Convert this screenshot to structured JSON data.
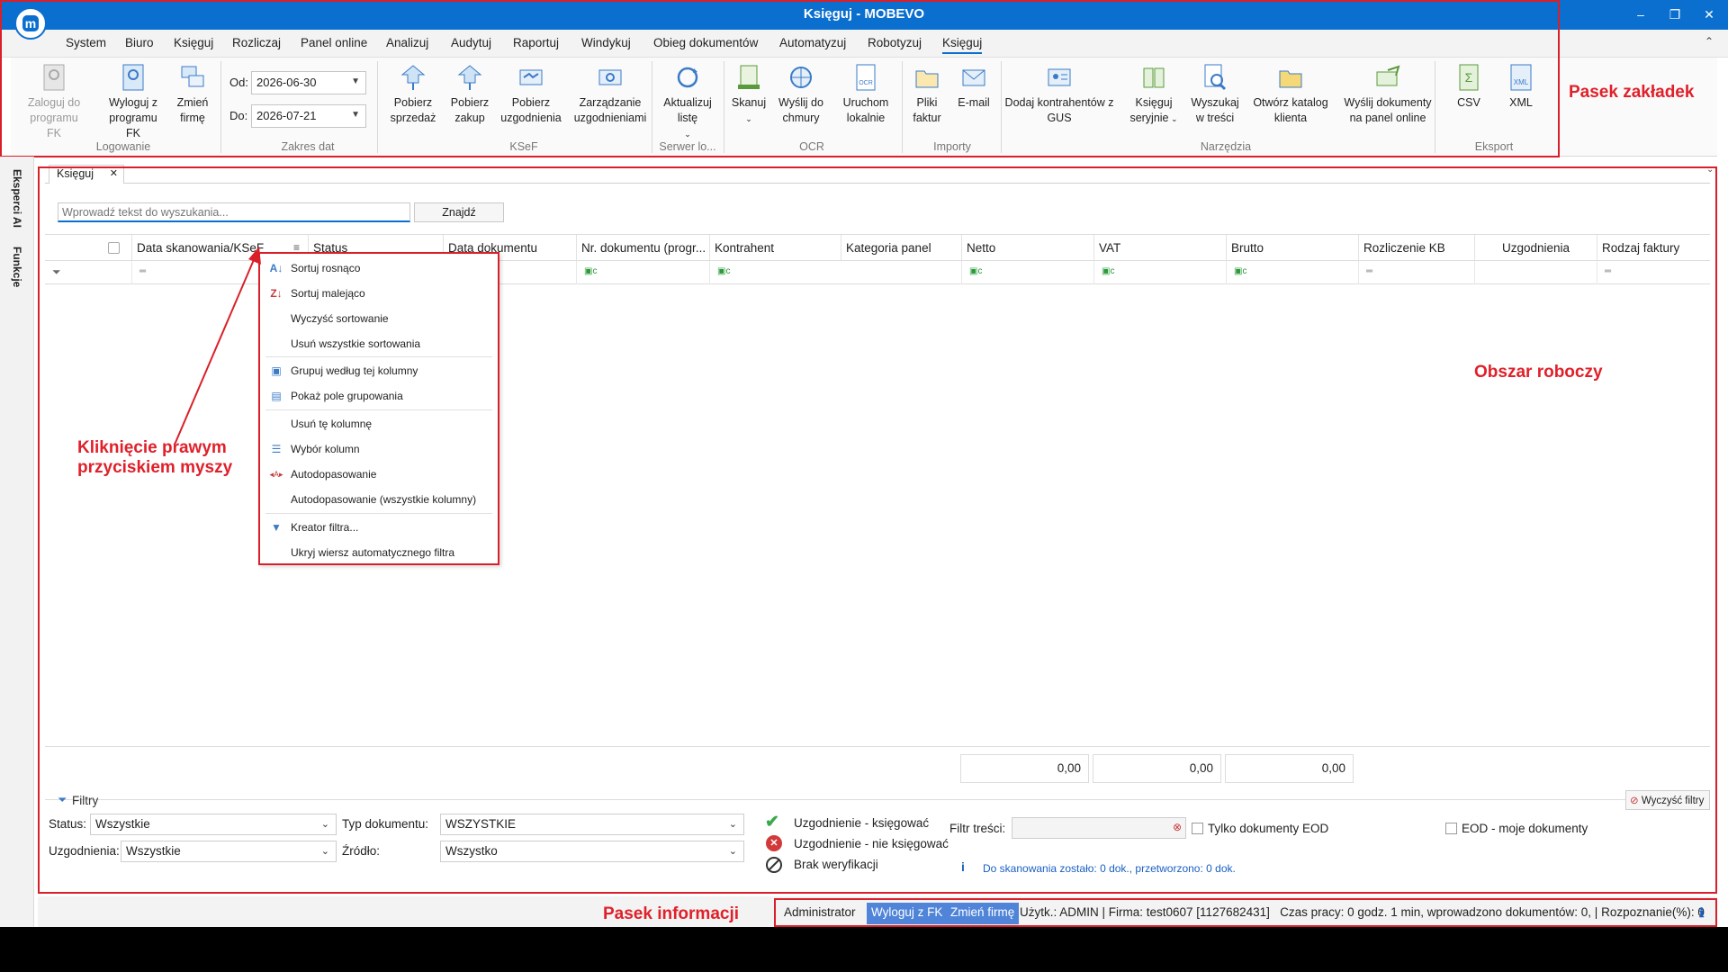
{
  "window": {
    "title": "Księguj  - MOBEVO",
    "minimize": "–",
    "restore": "❐",
    "close": "✕"
  },
  "menu": [
    "System",
    "Biuro",
    "Księguj",
    "Rozliczaj",
    "Panel online",
    "Analizuj",
    "Audytuj",
    "Raportuj",
    "Windykuj",
    "Obieg dokumentów",
    "Automatyzuj",
    "Robotyzuj",
    "Księguj"
  ],
  "ribbon": {
    "logowanie": {
      "login": "Zaloguj do programu FK",
      "logout": "Wyloguj z programu FK",
      "change": "Zmień firmę",
      "label": "Logowanie"
    },
    "dates": {
      "from_label": "Od:",
      "from": "2026-06-30",
      "to_label": "Do:",
      "to": "2026-07-21",
      "label": "Zakres dat"
    },
    "ksef": {
      "sales": "Pobierz sprzedaż",
      "purchase": "Pobierz zakup",
      "agreements": "Pobierz uzgodnienia",
      "manage": "Zarządzanie uzgodnieniami",
      "label": "KSeF"
    },
    "server": {
      "update": "Aktualizuj listę",
      "label": "Serwer lo..."
    },
    "ocr": {
      "scan": "Skanuj",
      "send_cloud": "Wyślij do chmury",
      "run_local": "Uruchom lokalnie",
      "label": "OCR"
    },
    "imports": {
      "files": "Pliki faktur",
      "email": "E-mail",
      "label": "Importy"
    },
    "tools": {
      "add_gus": "Dodaj kontrahentów z GUS",
      "serial": "Księguj seryjnie",
      "search_content": "Wyszukaj w treści",
      "open_catalog": "Otwórz katalog klienta",
      "send_panel": "Wyślij dokumenty na panel online",
      "label": "Narzędzia"
    },
    "export": {
      "csv": "CSV",
      "xml": "XML",
      "label": "Eksport"
    }
  },
  "annotations": {
    "tabs_bar": "Pasek zakładek",
    "workspace": "Obszar roboczy",
    "right_click": "Kliknięcie prawym przyciskiem myszy",
    "info_bar": "Pasek informacji"
  },
  "side": {
    "experts": "Eksperci AI",
    "functions": "Funkcje"
  },
  "workspace": {
    "tab": "Księguj",
    "search_placeholder": "Wprowadź tekst do wyszukania...",
    "find": "Znajdź",
    "columns": [
      "Data skanowania/KSeF",
      "Status",
      "Data dokumentu",
      "Nr. dokumentu (progr...",
      "Kontrahent",
      "Kategoria panel",
      "Netto",
      "VAT",
      "Brutto",
      "Rozliczenie KB",
      "Uzgodnienia",
      "Rodzaj faktury"
    ],
    "sums": [
      "0,00",
      "0,00",
      "0,00"
    ]
  },
  "context_menu": [
    "Sortuj rosnąco",
    "Sortuj malejąco",
    "Wyczyść sortowanie",
    "Usuń wszystkie sortowania",
    "Grupuj według tej kolumny",
    "Pokaż pole grupowania",
    "Usuń tę kolumnę",
    "Wybór kolumn",
    "Autodopasowanie",
    "Autodopasowanie (wszystkie kolumny)",
    "Kreator filtra...",
    "Ukryj wiersz automatycznego filtra"
  ],
  "filters": {
    "title": "Filtry",
    "clear": "Wyczyść filtry",
    "status_label": "Status:",
    "status": "Wszystkie",
    "agreements_label": "Uzgodnienia:",
    "agreements": "Wszystkie",
    "doctype_label": "Typ dokumentu:",
    "doctype": "WSZYSTKIE",
    "source_label": "Źródło:",
    "source": "Wszystko",
    "legend": [
      "Uzgodnienie - księgować",
      "Uzgodnienie - nie księgować",
      "Brak weryfikacji"
    ],
    "content_label": "Filtr treści:",
    "only_eod": "Tylko dokumenty EOD",
    "eod_mine": "EOD - moje dokumenty",
    "scan_info": "Do skanowania zostało: 0 dok., przetworzono: 0 dok."
  },
  "statusbar": {
    "user": "Administrator",
    "logout": "Wyloguj z FK",
    "change": "Zmień firmę",
    "info": "Użytk.: ADMIN | Firma: test0607 [1127682431]   Czas pracy: 0 godz. 1 min, wprowadzono dokumentów: 0, | Rozpoznanie(%): 0"
  },
  "colors": {
    "accent": "#0a6fcf",
    "annotation": "#d9202a",
    "status_button": "#4f84d8"
  }
}
